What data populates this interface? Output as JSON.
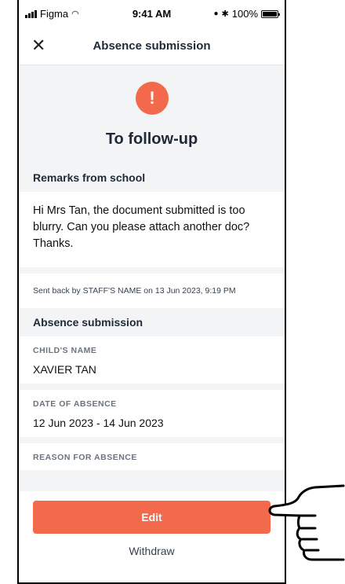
{
  "status_bar": {
    "carrier": "Figma",
    "time": "9:41 AM",
    "battery": "100%"
  },
  "header": {
    "close_icon": "close-icon",
    "title": "Absence submission"
  },
  "hero": {
    "icon": "exclamation-icon",
    "title": "To follow-up",
    "accent": "#f26a4b"
  },
  "remarks": {
    "heading": "Remarks from school",
    "text": "Hi Mrs Tan, the document submitted is too blurry. Can you please attach another doc? Thanks.",
    "sent_by": "Sent back by STAFF'S NAME on 13 Jun 2023, 9:19 PM"
  },
  "submission": {
    "heading": "Absence submission",
    "fields": [
      {
        "label": "CHILD'S NAME",
        "value": "XAVIER TAN"
      },
      {
        "label": "DATE OF ABSENCE",
        "value": "12 Jun 2023 - 14 Jun 2023"
      },
      {
        "label": "REASON FOR ABSENCE",
        "value": ""
      }
    ]
  },
  "actions": {
    "edit_label": "Edit",
    "withdraw_label": "Withdraw"
  }
}
